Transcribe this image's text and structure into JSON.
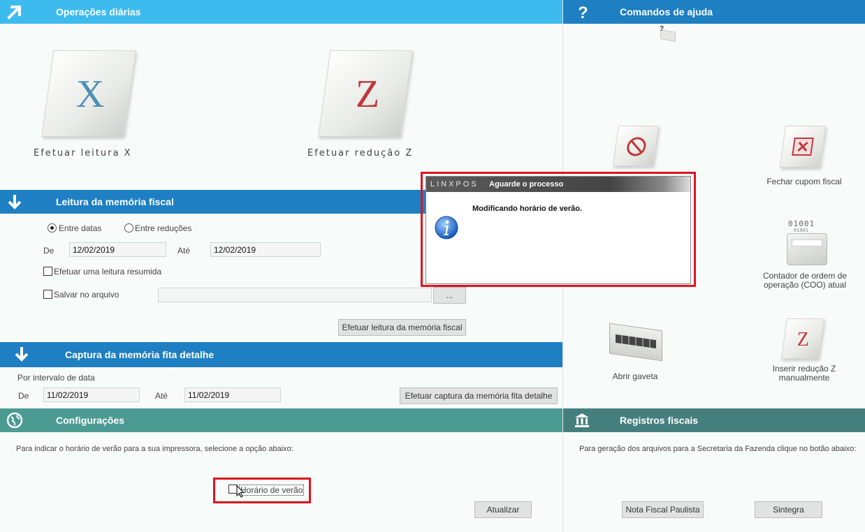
{
  "daily": {
    "title": "Operações diárias",
    "x_letter": "X",
    "x_label": "Efetuar leitura X",
    "z_letter": "Z",
    "z_label": "Efetuar redução Z"
  },
  "help": {
    "title": "Comandos de ajuda",
    "fechar_cupom": "Fechar cupom fiscal",
    "coo_bits1": "01001",
    "coo_bits2": "01001",
    "contador_line1": "Contador de ordem de",
    "contador_line2": "operação (COO) atual",
    "abrir_gaveta": "Abrir gaveta",
    "inserir_z_letter": "Z",
    "inserir_z_line1": "Inserir redução Z",
    "inserir_z_line2": "manualmente"
  },
  "memoria": {
    "title": "Leitura da memória fiscal",
    "radio_datas": "Entre datas",
    "radio_reducoes": "Entre reduções",
    "de_label": "De",
    "de_value": "12/02/2019",
    "ate_label": "Até",
    "ate_value": "12/02/2019",
    "resumida_label": "Efetuar uma leitura resumida",
    "salvar_label": "Salvar no arquivo",
    "browse_label": "...",
    "efetuar_button": "Efetuar leitura da memória fiscal"
  },
  "captura": {
    "title": "Captura da memória fita detalhe",
    "intervalo_label": "Por intervalo de data",
    "de_label": "De",
    "de_value": "11/02/2019",
    "ate_label": "Até",
    "ate_value": "11/02/2019",
    "efetuar_button": "Efetuar captura da memória fita detalhe"
  },
  "config": {
    "title": "Configurações",
    "description": "Para indicar o horário de verão para a sua impressora, selecione a opção abaixo:",
    "horario_label": "Horário de verão",
    "atualizar_button": "Atualizar"
  },
  "registros": {
    "title": "Registros fiscais",
    "description": "Para geração dos arquivos para a Secretaria da Fazenda clique no botão abaixo:",
    "nfp_button": "Nota Fiscal Paulista",
    "sintegra_button": "Sintegra"
  },
  "dialog": {
    "brand": "LINXPOS",
    "title": "Aguarde o processo",
    "message": "Modificando horário de verão."
  },
  "colors": {
    "header_light": "#3dbbef",
    "header_blue": "#1e7fc2",
    "header_teal": "#4b9b93",
    "header_teal_dark": "#447f7d",
    "highlight_red": "#e0141e"
  }
}
